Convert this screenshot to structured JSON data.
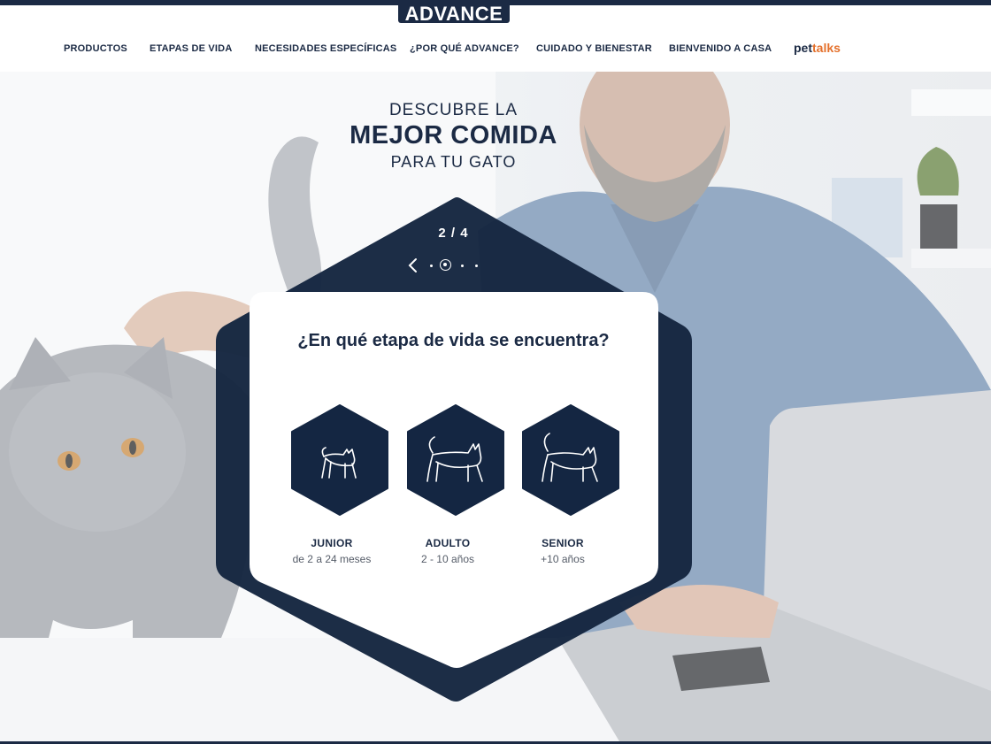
{
  "brand": {
    "logo_text": "ADVANCE"
  },
  "nav": {
    "items": [
      "PRODUCTOS",
      "ETAPAS DE VIDA",
      "NECESIDADES ESPECÍFICAS",
      "¿POR QUÉ ADVANCE?",
      "CUIDADO Y BIENESTAR",
      "BIENVENIDO A CASA"
    ],
    "pettalks_a": "pet",
    "pettalks_b": "talks"
  },
  "hero": {
    "line1": "DESCUBRE LA",
    "line2": "MEJOR COMIDA",
    "line3": "PARA TU GATO"
  },
  "carousel": {
    "counter": "2 / 4",
    "current": 2,
    "total": 4
  },
  "question": "¿En qué etapa de vida se encuentra?",
  "stages": [
    {
      "title": "JUNIOR",
      "subtitle": "de 2 a 24 meses",
      "icon": "kitten-icon"
    },
    {
      "title": "ADULTO",
      "subtitle": "2 - 10 años",
      "icon": "adult-cat-icon"
    },
    {
      "title": "SENIOR",
      "subtitle": "+10 años",
      "icon": "senior-cat-icon"
    }
  ],
  "colors": {
    "navy": "#1b2a44",
    "accent_orange": "#e4702b",
    "white": "#ffffff"
  }
}
